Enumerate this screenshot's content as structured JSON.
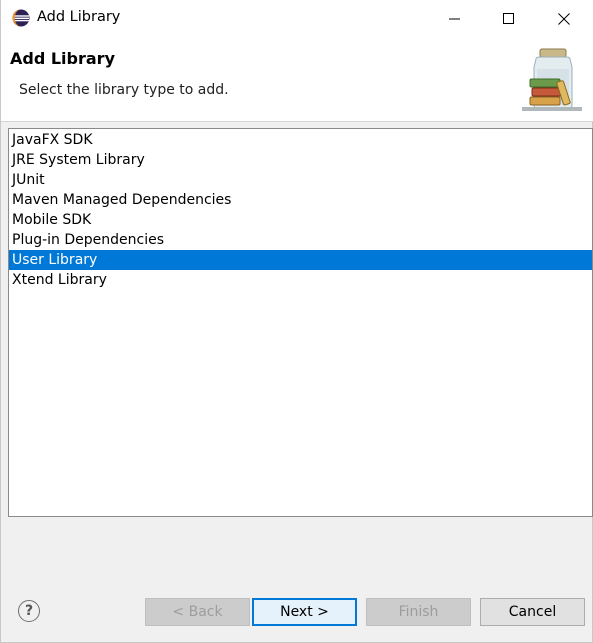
{
  "window": {
    "title": "Add Library"
  },
  "banner": {
    "title": "Add Library",
    "message": "Select the library type to add."
  },
  "list": {
    "items": [
      {
        "label": "JavaFX SDK",
        "selected": false
      },
      {
        "label": "JRE System Library",
        "selected": false
      },
      {
        "label": "JUnit",
        "selected": false
      },
      {
        "label": "Maven Managed Dependencies",
        "selected": false
      },
      {
        "label": "Mobile SDK",
        "selected": false
      },
      {
        "label": "Plug-in Dependencies",
        "selected": false
      },
      {
        "label": "User Library",
        "selected": true
      },
      {
        "label": "Xtend Library",
        "selected": false
      }
    ],
    "selection_color": "#0078d7"
  },
  "buttons": {
    "help": "?",
    "back": "< Back",
    "next": "Next >",
    "finish": "Finish",
    "cancel": "Cancel"
  }
}
